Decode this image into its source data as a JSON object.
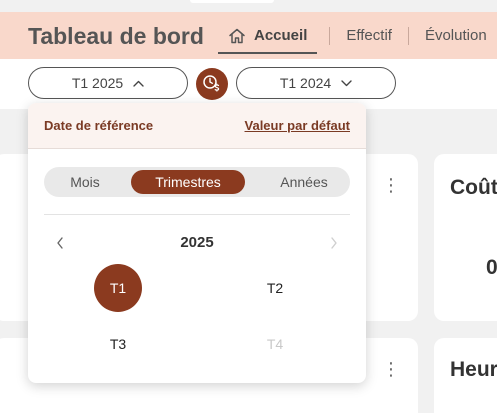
{
  "header": {
    "title": "Tableau de bord",
    "nav": [
      {
        "label": "Accueil",
        "icon": "home-icon",
        "active": true
      },
      {
        "label": "Effectif",
        "active": false
      },
      {
        "label": "Évolution",
        "active": false
      }
    ]
  },
  "filters": {
    "current_period": "T1 2025",
    "compare_period": "T1 2024",
    "compare_icon": "clock-currency-icon"
  },
  "cards": [
    {
      "title": "",
      "value": ""
    },
    {
      "title": "Coût",
      "value": "0"
    },
    {
      "title": "",
      "value": ""
    },
    {
      "title": "Heur",
      "value": ""
    }
  ],
  "picker": {
    "reference_label": "Date de référence",
    "default_label": "Valeur par défaut",
    "modes": [
      "Mois",
      "Trimestres",
      "Années"
    ],
    "active_mode": "Trimestres",
    "year": "2025",
    "quarters": [
      {
        "label": "T1",
        "state": "selected"
      },
      {
        "label": "T2",
        "state": "enabled"
      },
      {
        "label": "T3",
        "state": "enabled"
      },
      {
        "label": "T4",
        "state": "disabled"
      }
    ]
  },
  "colors": {
    "accent": "#8b3a1f",
    "header_bg": "#f9d8cb",
    "disabled_text": "#c8c8c8"
  }
}
